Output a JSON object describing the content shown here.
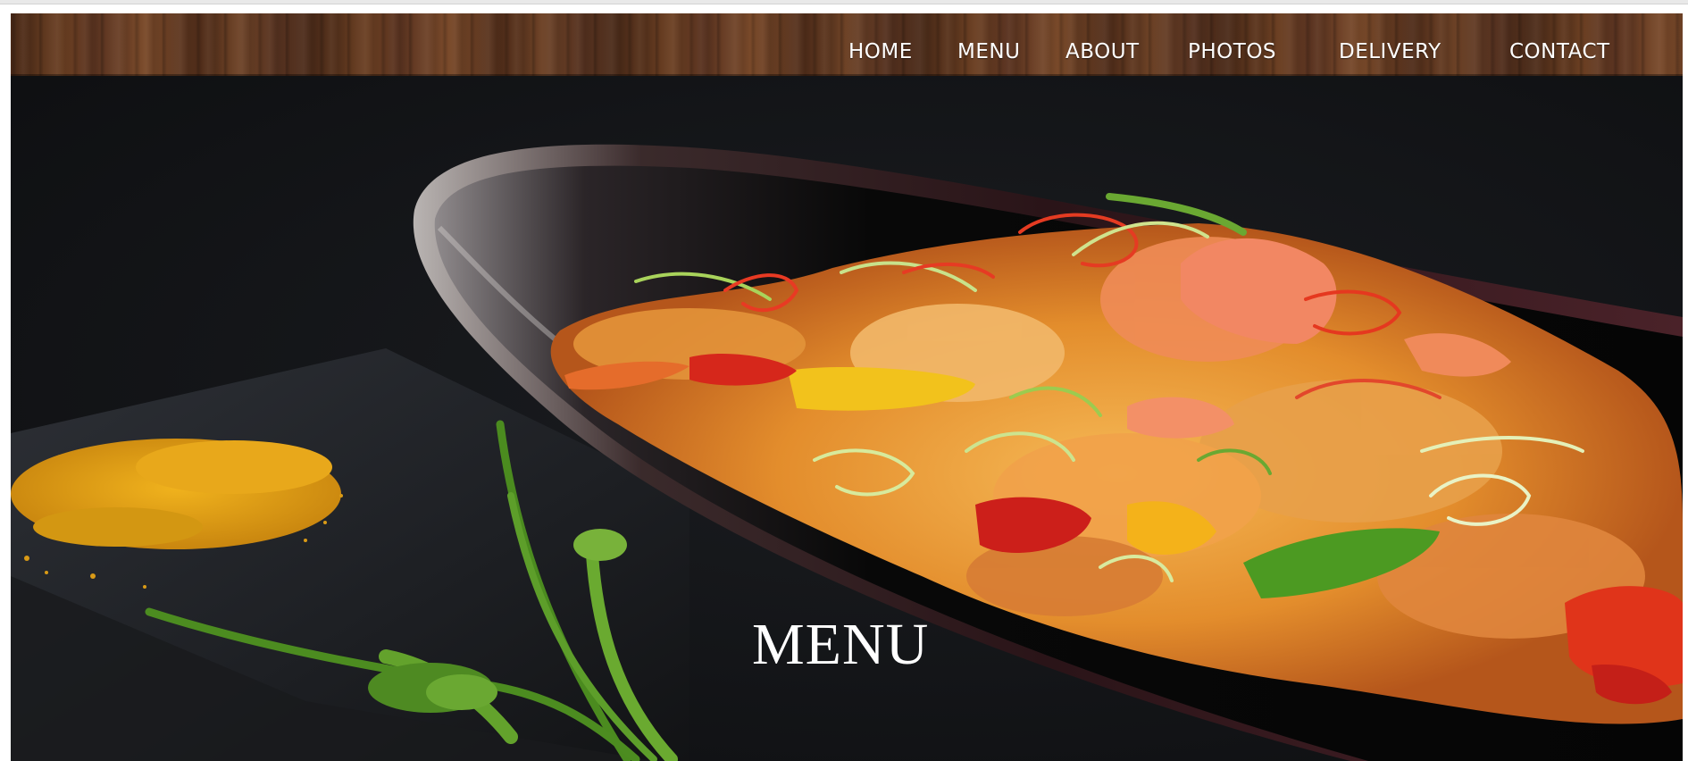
{
  "nav": {
    "items": [
      {
        "label": "HOME"
      },
      {
        "label": "MENU"
      },
      {
        "label": "ABOUT"
      },
      {
        "label": "PHOTOS"
      },
      {
        "label": "DELIVERY"
      },
      {
        "label": "CONTACT"
      }
    ]
  },
  "hero": {
    "title": "MENU",
    "image": "seafood-curry-dish-photo"
  },
  "colors": {
    "nav_text": "#ffffff",
    "hero_background": "#111214",
    "wood_dark": "#4a2a18",
    "wood_light": "#7a4a2a",
    "turmeric": "#d99a16"
  }
}
